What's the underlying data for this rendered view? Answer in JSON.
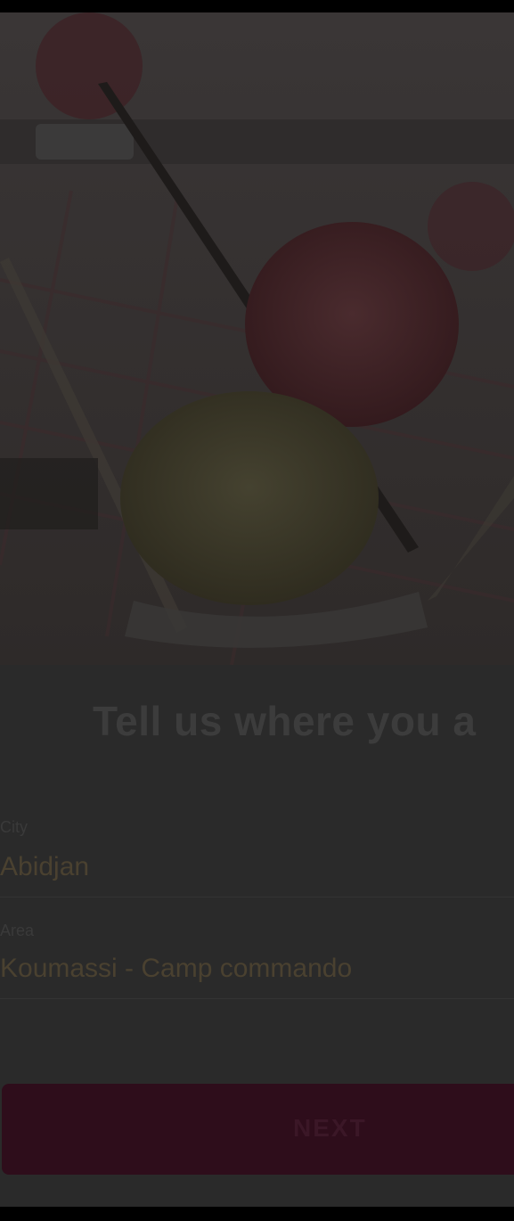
{
  "hero": {
    "image": "ice-cream-with-wafers-photo"
  },
  "form": {
    "headline": "Tell us where you a",
    "city": {
      "label": "City",
      "value": "Abidjan"
    },
    "area": {
      "label": "Area",
      "value": "Koumassi - Camp commando"
    },
    "next_label": "NEXT"
  },
  "colors": {
    "overlay": "#2a2a2a",
    "button": "#2e0d1b"
  }
}
